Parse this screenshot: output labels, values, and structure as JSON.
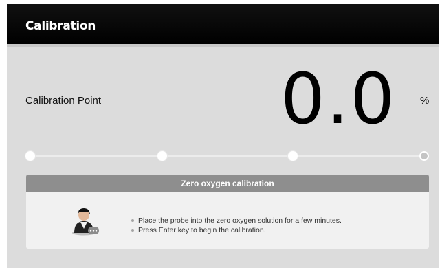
{
  "header": {
    "title": "Calibration"
  },
  "calibration": {
    "point_label": "Calibration Point",
    "value": "0.0",
    "unit": "%",
    "steps_total": 4,
    "steps_completed": 1
  },
  "panel": {
    "title": "Zero oxygen calibration",
    "icon": "operator-icon",
    "instructions": [
      "Place the probe into the zero oxygen solution for a few minutes.",
      "Press Enter key to begin the calibration."
    ]
  }
}
